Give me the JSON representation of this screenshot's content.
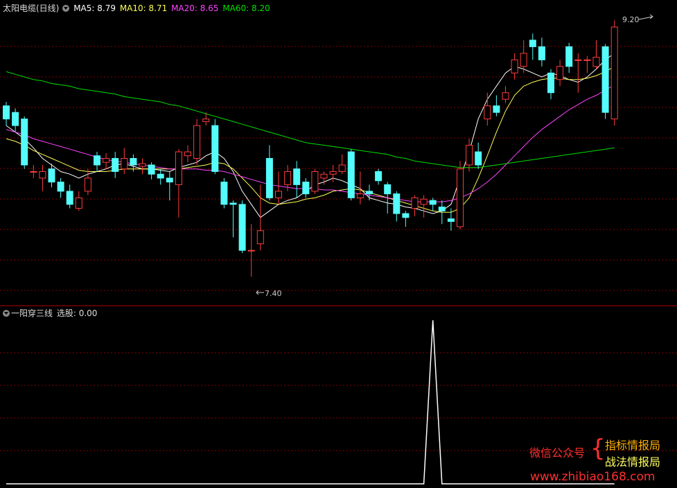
{
  "header": {
    "title": "太阳电缆(日线)",
    "ma5": "MA5: 8.79",
    "ma10": "MA10: 8.71",
    "ma20": "MA20: 8.65",
    "ma60": "MA60: 8.20"
  },
  "indicator": {
    "name": "一阳穿三线",
    "value": "选股: 0.00"
  },
  "annotations": {
    "high": "9.20",
    "low": "7.40"
  },
  "watermark": {
    "label": "微信公众号",
    "brace": "{",
    "line1": "指标情报局",
    "line2": "战法情报局",
    "url": "www.zhibiao168.com"
  },
  "colors": {
    "up": "#ff3c3c",
    "down": "#54fcfc",
    "ma5": "#ffffff",
    "ma10": "#ffff55",
    "ma20": "#ff44ff",
    "ma60": "#00e000",
    "grid": "#8a0000",
    "frame": "#b00000"
  },
  "chart_data": [
    {
      "type": "candlestick",
      "title": "太阳电缆(日线)",
      "ylim": [
        7.2,
        9.4
      ],
      "series": [
        {
          "name": "MA5",
          "color": "#ffffff",
          "values": [
            8.55,
            8.5,
            8.45,
            8.38,
            8.3,
            8.25,
            8.2,
            8.18,
            8.15,
            8.18,
            8.2,
            8.22,
            8.25,
            8.26,
            8.24,
            8.22,
            8.22,
            8.21,
            8.2,
            8.23,
            8.25,
            8.27,
            8.32,
            8.35,
            8.3,
            8.2,
            8.05,
            7.95,
            7.85,
            7.9,
            7.95,
            7.98,
            8.0,
            8.05,
            8.1,
            8.12,
            8.15,
            8.13,
            8.1,
            8.07,
            8.0,
            7.98,
            7.96,
            7.95,
            7.93,
            7.92,
            7.9,
            7.88,
            7.9,
            7.95,
            8.15,
            8.35,
            8.6,
            8.75,
            8.85,
            8.95,
            9.0,
            8.98,
            8.95,
            8.92,
            8.95,
            8.93,
            8.9,
            8.88,
            8.92,
            8.98,
            9.05,
            9.1
          ]
        },
        {
          "name": "MA10",
          "color": "#ffff55",
          "values": [
            8.45,
            8.43,
            8.4,
            8.36,
            8.33,
            8.3,
            8.27,
            8.24,
            8.21,
            8.2,
            8.2,
            8.2,
            8.21,
            8.22,
            8.22,
            8.22,
            8.22,
            8.22,
            8.22,
            8.22,
            8.23,
            8.24,
            8.25,
            8.27,
            8.26,
            8.22,
            8.15,
            8.08,
            8.0,
            7.96,
            7.95,
            7.96,
            7.97,
            7.99,
            8.0,
            8.02,
            8.05,
            8.06,
            8.07,
            8.06,
            8.04,
            8.02,
            8.0,
            7.98,
            7.96,
            7.94,
            7.92,
            7.9,
            7.89,
            7.89,
            7.92,
            8.0,
            8.15,
            8.32,
            8.5,
            8.66,
            8.78,
            8.85,
            8.88,
            8.9,
            8.91,
            8.91,
            8.9,
            8.9,
            8.91,
            8.93,
            8.96,
            9.0
          ]
        },
        {
          "name": "MA20",
          "color": "#ff44ff",
          "values": [
            8.52,
            8.5,
            8.48,
            8.45,
            8.43,
            8.41,
            8.39,
            8.37,
            8.35,
            8.33,
            8.31,
            8.29,
            8.28,
            8.27,
            8.26,
            8.25,
            8.24,
            8.23,
            8.22,
            8.22,
            8.22,
            8.22,
            8.21,
            8.21,
            8.2,
            8.18,
            8.16,
            8.14,
            8.12,
            8.1,
            8.09,
            8.08,
            8.07,
            8.07,
            8.07,
            8.06,
            8.06,
            8.05,
            8.04,
            8.03,
            8.02,
            8.01,
            8.0,
            7.99,
            7.98,
            7.97,
            7.97,
            7.97,
            7.97,
            7.98,
            8.0,
            8.03,
            8.07,
            8.12,
            8.18,
            8.25,
            8.32,
            8.39,
            8.46,
            8.52,
            8.57,
            8.62,
            8.67,
            8.71,
            8.75,
            8.78,
            8.82,
            8.86
          ]
        },
        {
          "name": "MA60",
          "color": "#00e000",
          "values": [
            8.96,
            8.94,
            8.92,
            8.9,
            8.89,
            8.87,
            8.86,
            8.85,
            8.83,
            8.82,
            8.81,
            8.8,
            8.79,
            8.77,
            8.76,
            8.75,
            8.74,
            8.73,
            8.71,
            8.7,
            8.68,
            8.66,
            8.64,
            8.62,
            8.6,
            8.58,
            8.56,
            8.54,
            8.52,
            8.5,
            8.48,
            8.46,
            8.44,
            8.42,
            8.41,
            8.4,
            8.39,
            8.38,
            8.37,
            8.36,
            8.35,
            8.34,
            8.33,
            8.31,
            8.3,
            8.28,
            8.27,
            8.26,
            8.25,
            8.24,
            8.23,
            8.23,
            8.23,
            8.24,
            8.25,
            8.26,
            8.27,
            8.28,
            8.29,
            8.3,
            8.31,
            8.32,
            8.33,
            8.34,
            8.35,
            8.36,
            8.37,
            8.38
          ]
        }
      ],
      "candles": [
        [
          8.7,
          8.6,
          8.73,
          8.55
        ],
        [
          8.65,
          8.55,
          8.68,
          8.5
        ],
        [
          8.6,
          8.25,
          8.62,
          8.22
        ],
        [
          8.2,
          8.2,
          8.25,
          8.15
        ],
        [
          8.15,
          8.2,
          8.25,
          8.05
        ],
        [
          8.22,
          8.12,
          8.26,
          8.08
        ],
        [
          8.12,
          8.05,
          8.15,
          8.0
        ],
        [
          8.05,
          7.95,
          8.1,
          7.92
        ],
        [
          7.92,
          8.0,
          8.05,
          7.9
        ],
        [
          8.05,
          8.15,
          8.22,
          8.02
        ],
        [
          8.32,
          8.25,
          8.35,
          8.2
        ],
        [
          8.27,
          8.3,
          8.34,
          8.22
        ],
        [
          8.3,
          8.2,
          8.35,
          8.15
        ],
        [
          8.22,
          8.3,
          8.38,
          8.18
        ],
        [
          8.3,
          8.25,
          8.33,
          8.2
        ],
        [
          8.24,
          8.26,
          8.3,
          8.18
        ],
        [
          8.25,
          8.18,
          8.27,
          8.14
        ],
        [
          8.18,
          8.15,
          8.22,
          8.1
        ],
        [
          8.15,
          8.12,
          8.2,
          7.98
        ],
        [
          8.1,
          8.35,
          8.37,
          7.85
        ],
        [
          8.32,
          8.35,
          8.4,
          8.27
        ],
        [
          8.3,
          8.55,
          8.6,
          8.25
        ],
        [
          8.58,
          8.6,
          8.65,
          8.55
        ],
        [
          8.55,
          8.2,
          8.6,
          8.18
        ],
        [
          8.12,
          7.95,
          8.15,
          7.92
        ],
        [
          7.96,
          7.95,
          7.98,
          7.7
        ],
        [
          7.95,
          7.6,
          7.98,
          7.58
        ],
        [
          7.6,
          7.6,
          7.8,
          7.4
        ],
        [
          7.65,
          7.75,
          8.1,
          7.6
        ],
        [
          8.3,
          8.0,
          8.4,
          7.98
        ],
        [
          8.0,
          8.05,
          8.2,
          7.95
        ],
        [
          8.1,
          8.2,
          8.25,
          8.05
        ],
        [
          8.22,
          8.1,
          8.28,
          8.0
        ],
        [
          8.12,
          8.03,
          8.15,
          8.0
        ],
        [
          8.05,
          8.2,
          8.22,
          8.03
        ],
        [
          8.15,
          8.18,
          8.2,
          8.1
        ],
        [
          8.18,
          8.2,
          8.25,
          8.12
        ],
        [
          8.2,
          8.25,
          8.33,
          8.18
        ],
        [
          8.35,
          8.0,
          8.37,
          7.98
        ],
        [
          8.0,
          8.03,
          8.2,
          7.95
        ],
        [
          8.05,
          8.03,
          8.1,
          7.98
        ],
        [
          8.2,
          8.13,
          8.22,
          8.1
        ],
        [
          8.1,
          8.03,
          8.12,
          7.88
        ],
        [
          8.03,
          7.88,
          8.05,
          7.82
        ],
        [
          7.88,
          7.85,
          7.9,
          7.78
        ],
        [
          7.92,
          8.0,
          8.02,
          7.86
        ],
        [
          7.95,
          7.99,
          8.02,
          7.85
        ],
        [
          7.98,
          7.95,
          8.0,
          7.9
        ],
        [
          7.93,
          7.9,
          7.98,
          7.8
        ],
        [
          7.84,
          7.82,
          7.92,
          7.75
        ],
        [
          7.78,
          8.22,
          8.28,
          7.76
        ],
        [
          8.25,
          8.4,
          8.45,
          8.2
        ],
        [
          8.35,
          8.25,
          8.42,
          8.22
        ],
        [
          8.6,
          8.7,
          8.8,
          8.55
        ],
        [
          8.7,
          8.65,
          8.78,
          8.62
        ],
        [
          8.75,
          8.8,
          8.85,
          8.72
        ],
        [
          8.95,
          9.05,
          9.1,
          8.9
        ],
        [
          9.0,
          9.1,
          9.2,
          8.95
        ],
        [
          9.2,
          9.15,
          9.25,
          9.05
        ],
        [
          9.15,
          9.05,
          9.22,
          9.0
        ],
        [
          8.95,
          8.8,
          8.98,
          8.75
        ],
        [
          8.9,
          9.0,
          9.05,
          8.85
        ],
        [
          9.15,
          9.0,
          9.18,
          8.95
        ],
        [
          9.05,
          9.05,
          9.1,
          8.8
        ],
        [
          9.05,
          9.05,
          9.08,
          8.95
        ],
        [
          9.0,
          9.07,
          9.2,
          8.98
        ],
        [
          9.15,
          8.65,
          9.17,
          8.6
        ],
        [
          8.6,
          9.3,
          9.35,
          8.55
        ]
      ]
    },
    {
      "type": "line",
      "title": "一阳穿三线",
      "series": [
        {
          "name": "选股",
          "values": [
            0,
            0,
            0,
            0,
            0,
            0,
            0,
            0,
            0,
            0,
            0,
            0,
            0,
            0,
            0,
            0,
            0,
            0,
            0,
            0,
            0,
            0,
            0,
            0,
            0,
            0,
            0,
            0,
            0,
            0,
            0,
            0,
            0,
            0,
            0,
            0,
            0,
            0,
            0,
            0,
            0,
            0,
            0,
            0,
            0,
            0,
            0,
            1,
            0,
            0,
            0,
            0,
            0,
            0,
            0,
            0,
            0,
            0,
            0,
            0,
            0,
            0,
            0,
            0,
            0,
            0,
            0,
            0
          ]
        }
      ]
    }
  ]
}
